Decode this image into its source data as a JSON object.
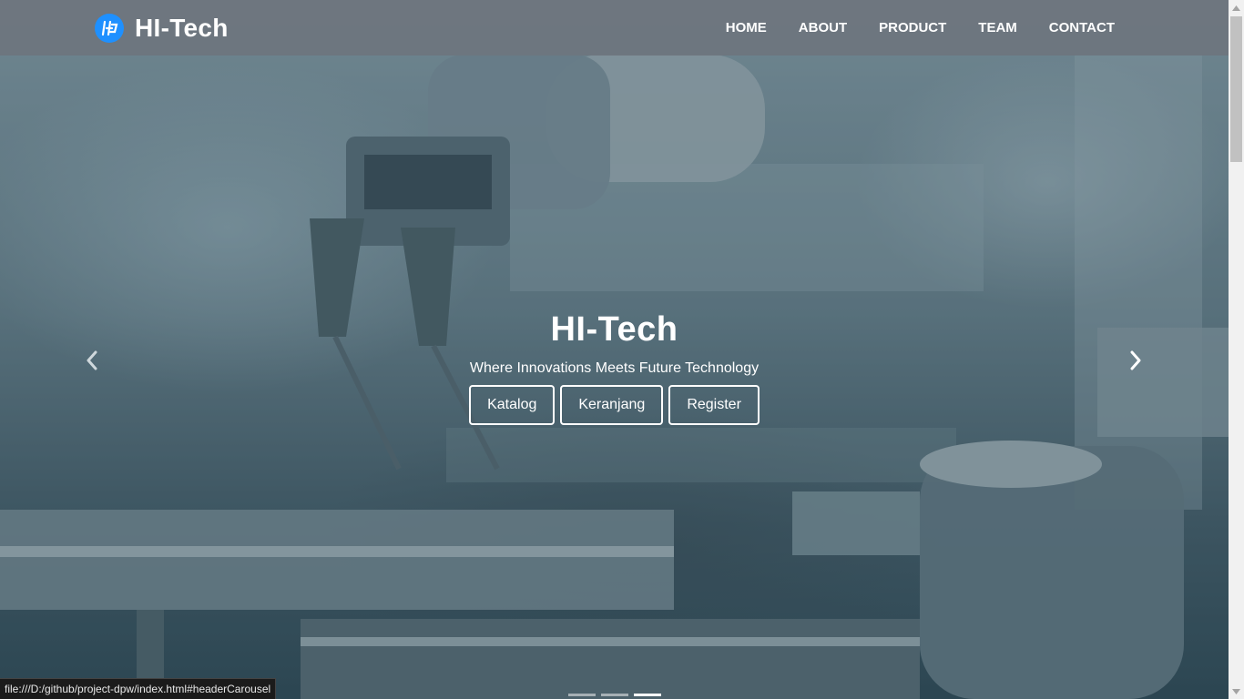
{
  "navbar": {
    "brand": "HI-Tech",
    "logo_icon": "hp-globe-icon",
    "logo_color": "#1e90ff",
    "links": [
      {
        "label": "HOME"
      },
      {
        "label": "ABOUT"
      },
      {
        "label": "PRODUCT"
      },
      {
        "label": "TEAM"
      },
      {
        "label": "CONTACT"
      }
    ]
  },
  "hero": {
    "title": "HI-Tech",
    "subtitle": "Where Innovations Meets Future Technology",
    "buttons": [
      {
        "label": "Katalog"
      },
      {
        "label": "Keranjang"
      },
      {
        "label": "Register"
      }
    ],
    "prev_icon": "chevron-left-icon",
    "next_icon": "chevron-right-icon",
    "slide_count": 3,
    "active_slide": 3
  },
  "status_bar": {
    "url": "file:///D:/github/project-dpw/index.html#headerCarousel"
  }
}
